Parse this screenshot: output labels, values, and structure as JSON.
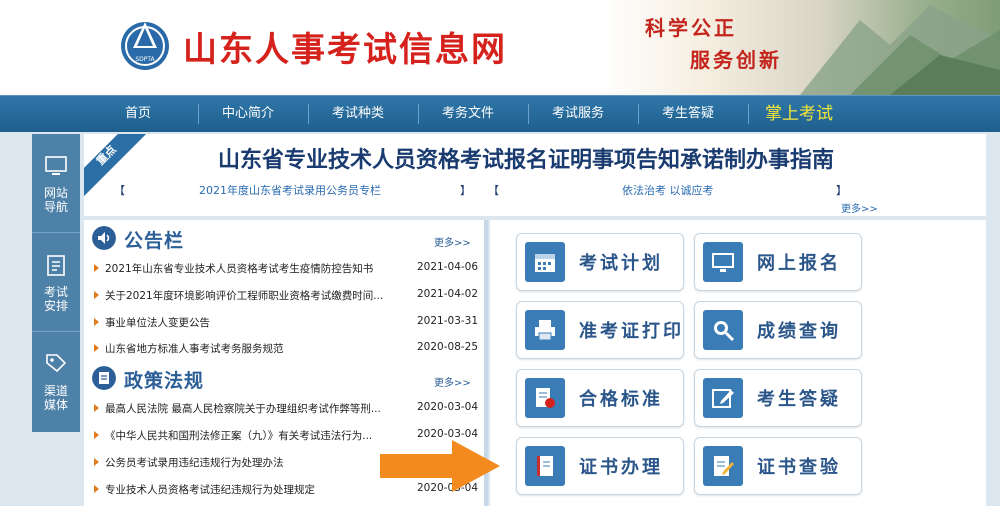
{
  "header": {
    "site_title": "山东人事考试信息网",
    "logo_text": "SDPTA",
    "slogan_line1": "科学公正",
    "slogan_line2": "服务创新"
  },
  "nav": {
    "items": [
      "首页",
      "中心简介",
      "考试种类",
      "考务文件",
      "考试服务",
      "考生答疑"
    ],
    "highlight": "掌上考试"
  },
  "sidebar": {
    "items": [
      {
        "label": "网站\n导航",
        "icon": "monitor-icon"
      },
      {
        "label": "考试\n安排",
        "icon": "clipboard-icon"
      },
      {
        "label": "渠道\n媒体",
        "icon": "tag-icon"
      }
    ]
  },
  "banner": {
    "ribbon": "重点",
    "title": "山东省专业技术人员资格考试报名证明事项告知承诺制办事指南",
    "bracket_open": "【",
    "bracket_close": "】",
    "link1": "2021年度山东省考试录用公务员专栏",
    "link2": "依法治考 以诚应考",
    "more": "更多>>"
  },
  "bulletin": {
    "title": "公告栏",
    "more": "更多>>",
    "items": [
      {
        "title": "2021年山东省专业技术人员资格考试考生疫情防控告知书",
        "date": "2021-04-06"
      },
      {
        "title": "关于2021年度环境影响评价工程师职业资格考试缴费时间...",
        "date": "2021-04-02"
      },
      {
        "title": "事业单位法人变更公告",
        "date": "2021-03-31"
      },
      {
        "title": "山东省地方标准人事考试考务服务规范",
        "date": "2020-08-25"
      }
    ]
  },
  "policy": {
    "title": "政策法规",
    "more": "更多>>",
    "items": [
      {
        "title": "最高人民法院 最高人民检察院关于办理组织考试作弊等刑...",
        "date": "2020-03-04"
      },
      {
        "title": "《中华人民共和国刑法修正案（九）》有关考试违法行为...",
        "date": "2020-03-04"
      },
      {
        "title": "公务员考试录用违纪违规行为处理办法",
        "date": ""
      },
      {
        "title": "专业技术人员资格考试违纪违规行为处理规定",
        "date": "2020-03-04"
      }
    ]
  },
  "services": [
    {
      "label": "考试计划",
      "icon": "calendar-icon"
    },
    {
      "label": "网上报名",
      "icon": "monitor-icon"
    },
    {
      "label": "准考证打印",
      "icon": "printer-icon"
    },
    {
      "label": "成绩查询",
      "icon": "magnifier-icon"
    },
    {
      "label": "合格标准",
      "icon": "certificate-icon"
    },
    {
      "label": "考生答疑",
      "icon": "edit-icon"
    },
    {
      "label": "证书办理",
      "icon": "book-icon"
    },
    {
      "label": "证书查验",
      "icon": "document-check-icon"
    }
  ],
  "colors": {
    "nav_bg": "#1f5f8e",
    "title_red": "#d6221c",
    "accent_blue": "#2c5f97",
    "highlight_yellow": "#f3e63a",
    "arrow_orange": "#f28a1e"
  }
}
